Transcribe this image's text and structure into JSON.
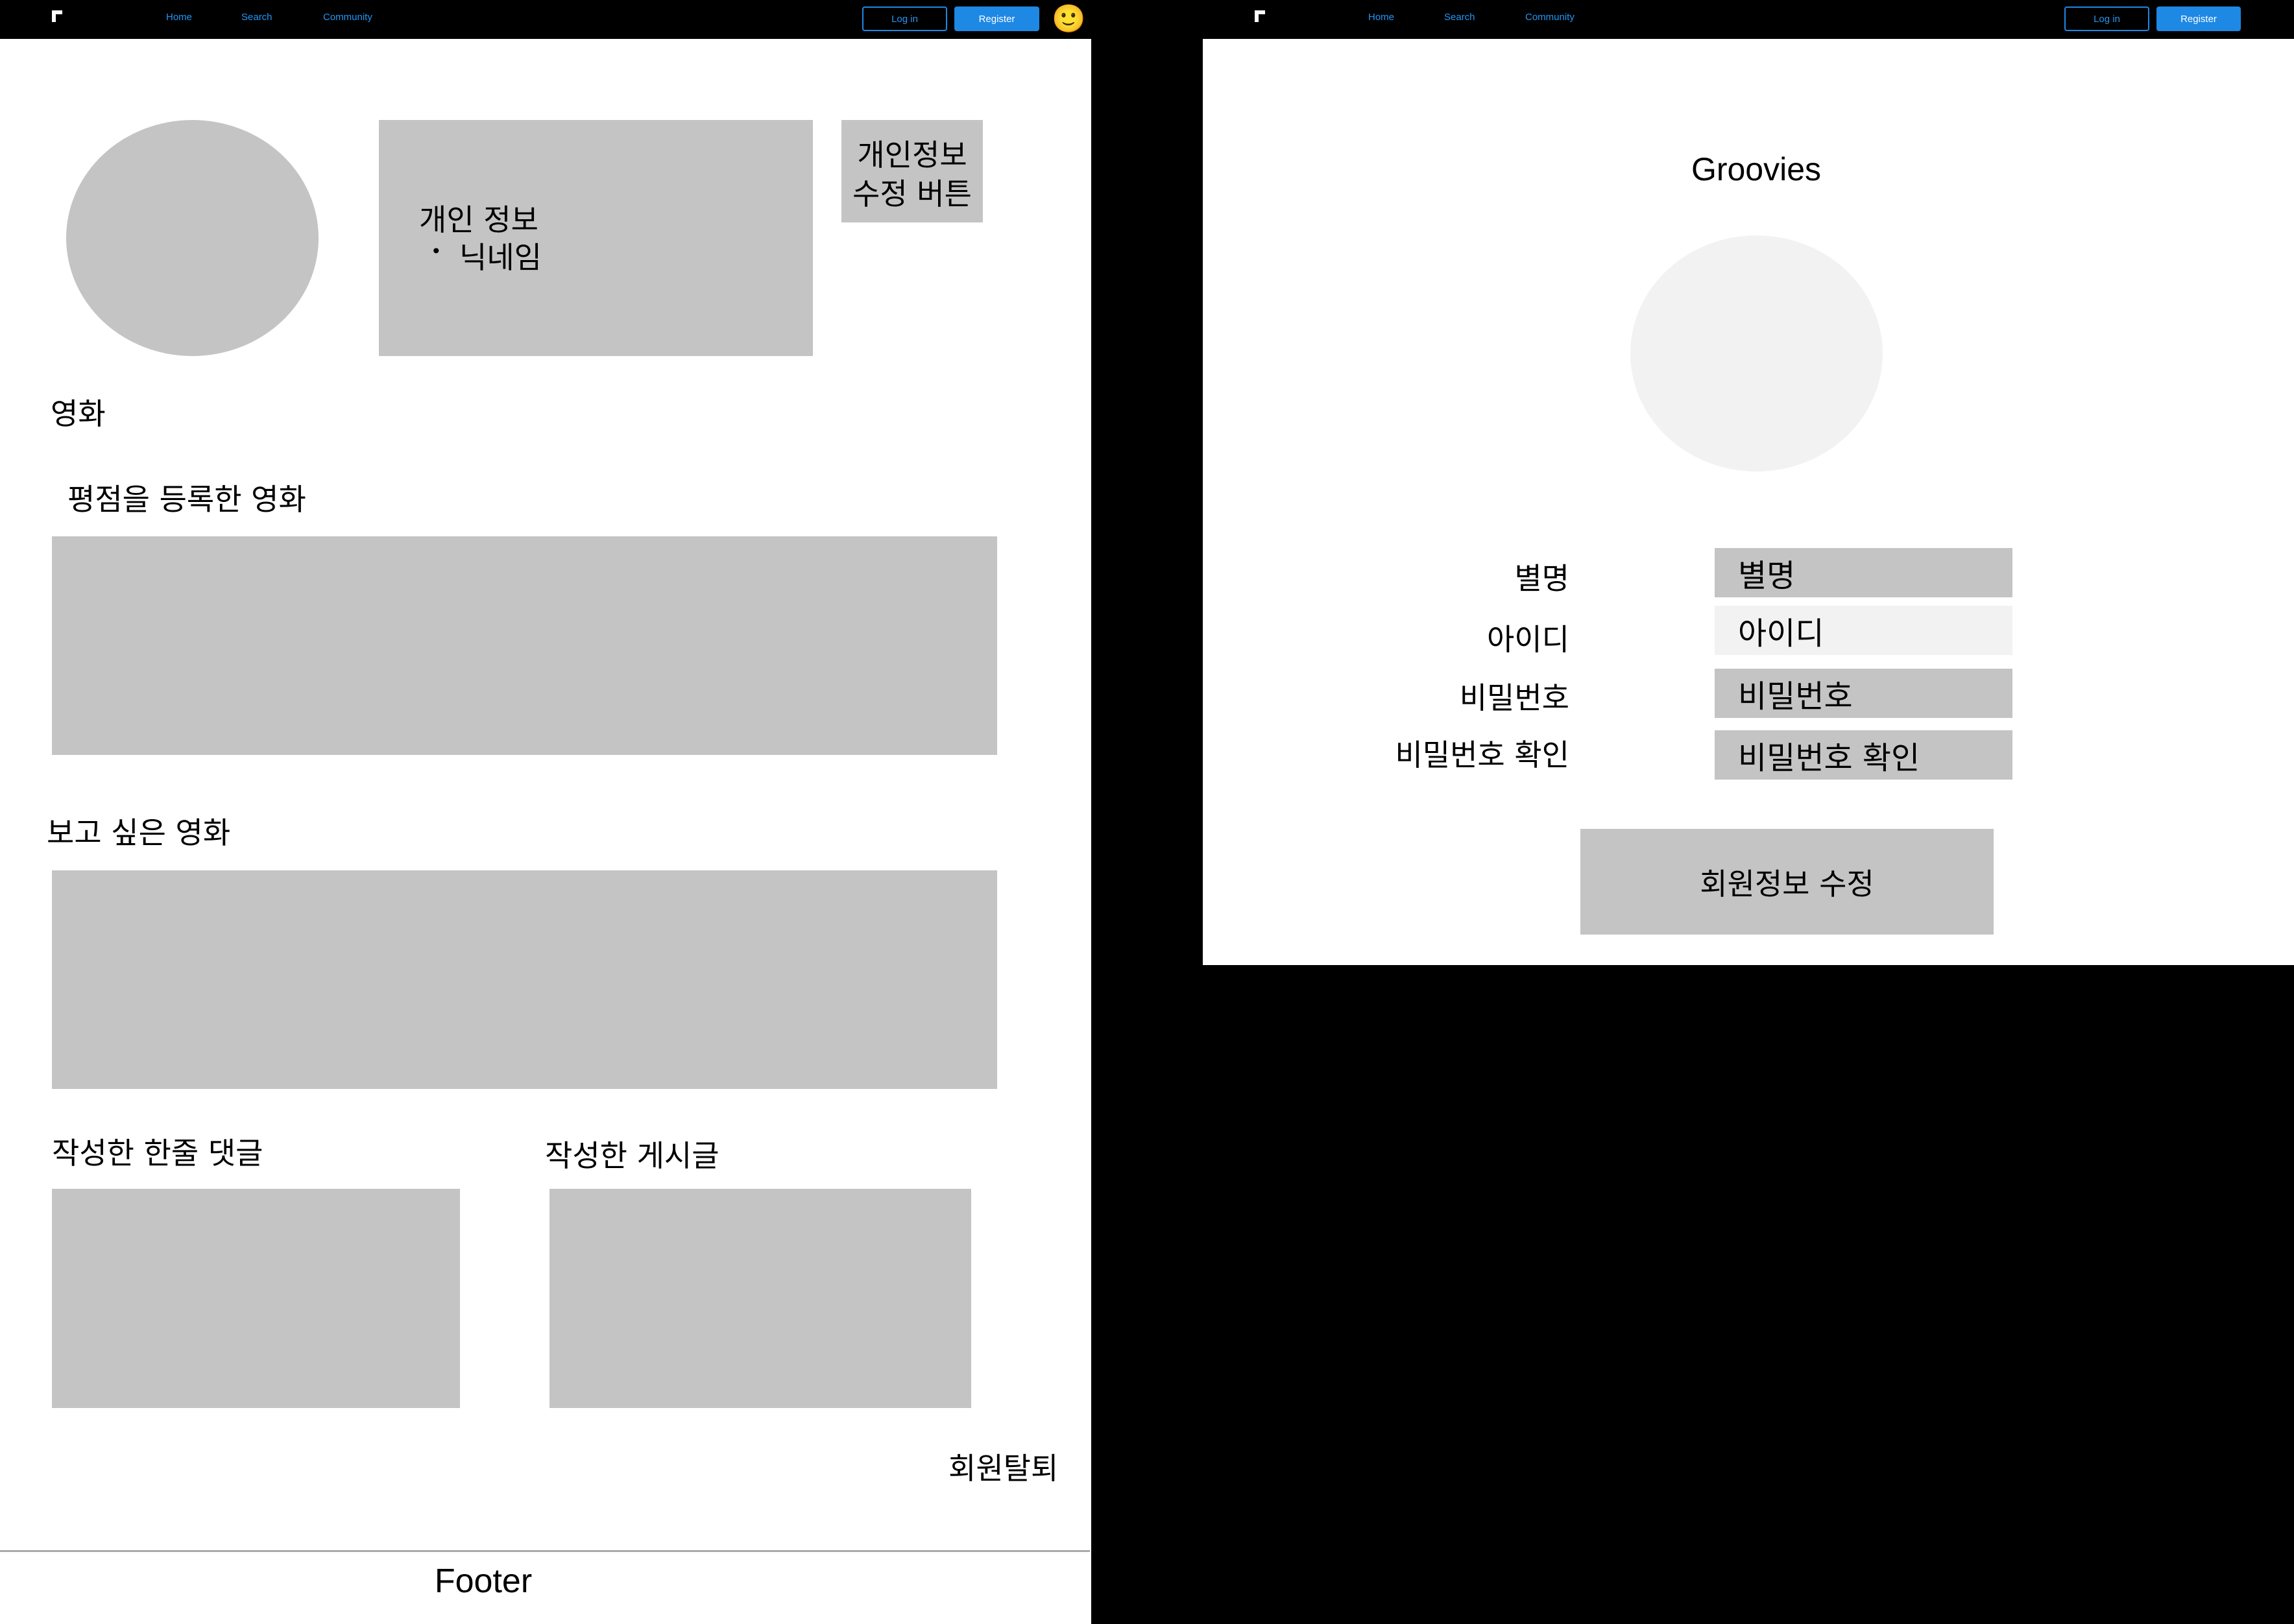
{
  "left_page": {
    "nav": {
      "links": [
        "Home",
        "Search",
        "Community"
      ],
      "login_label": "Log in",
      "register_label": "Register",
      "avatar_emoji": "🙂"
    },
    "profile_info": {
      "title": "개인 정보",
      "bullet": "•",
      "item": "닉네임"
    },
    "edit_button_line1": "개인정보",
    "edit_button_line2": "수정 버튼",
    "movies_heading": "영화",
    "rated_movies_heading": "평점을 등록한 영화",
    "wishlist_heading": "보고 싶은 영화",
    "comments_heading": "작성한 한줄 댓글",
    "posts_heading": "작성한 게시글",
    "withdraw_label": "회원탈퇴",
    "footer_label": "Footer"
  },
  "right_page": {
    "nav": {
      "links": [
        "Home",
        "Search",
        "Community"
      ],
      "login_label": "Log in",
      "register_label": "Register"
    },
    "brand_title": "Groovies",
    "fields": [
      {
        "label": "별명",
        "value": "별명"
      },
      {
        "label": "아이디",
        "value": "아이디"
      },
      {
        "label": "비밀번호",
        "value": "비밀번호"
      },
      {
        "label": "비밀번호 확인",
        "value": "비밀번호 확인"
      }
    ],
    "submit_label": "회원정보 수정"
  },
  "colors": {
    "accent": "#1e88e5",
    "placeholder_gray": "#c4c4c4",
    "light_gray": "#f2f2f2",
    "background": "#000000"
  }
}
